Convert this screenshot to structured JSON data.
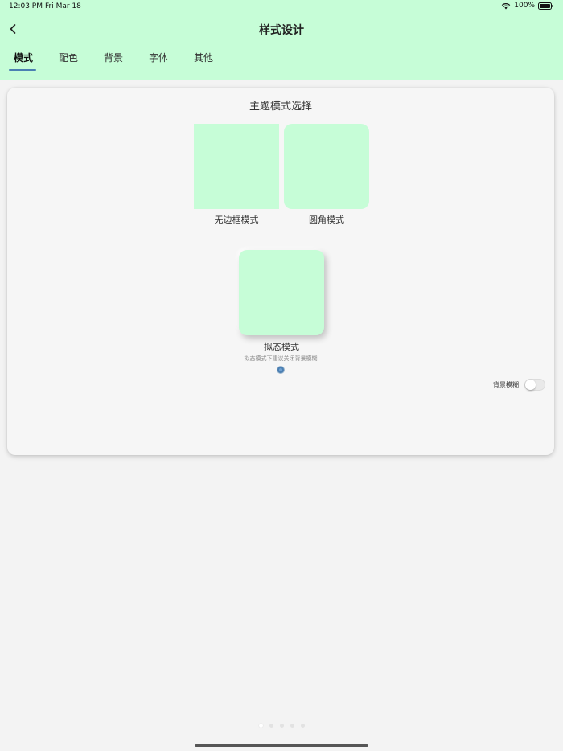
{
  "status_bar": {
    "time": "12:03 PM",
    "date": "Fri Mar 18",
    "battery": "100%"
  },
  "header": {
    "title": "样式设计",
    "back_icon": "chevron-left-icon"
  },
  "tabs": [
    {
      "label": "模式",
      "active": true
    },
    {
      "label": "配色",
      "active": false
    },
    {
      "label": "背景",
      "active": false
    },
    {
      "label": "字体",
      "active": false
    },
    {
      "label": "其他",
      "active": false
    }
  ],
  "card": {
    "title": "主题模式选择",
    "modes": [
      {
        "label": "无边框模式"
      },
      {
        "label": "圆角模式"
      },
      {
        "label": "拟态模式",
        "hint": "拟态模式下建议关闭背景模糊",
        "selected": true
      }
    ],
    "blur_toggle": {
      "label": "背景模糊",
      "on": false
    }
  },
  "colors": {
    "accent_green": "#c6fdd7",
    "tab_indicator": "#4b7fb3",
    "background": "#f3f3f3"
  },
  "page_indicator": {
    "count": 5,
    "active_index": 0
  }
}
